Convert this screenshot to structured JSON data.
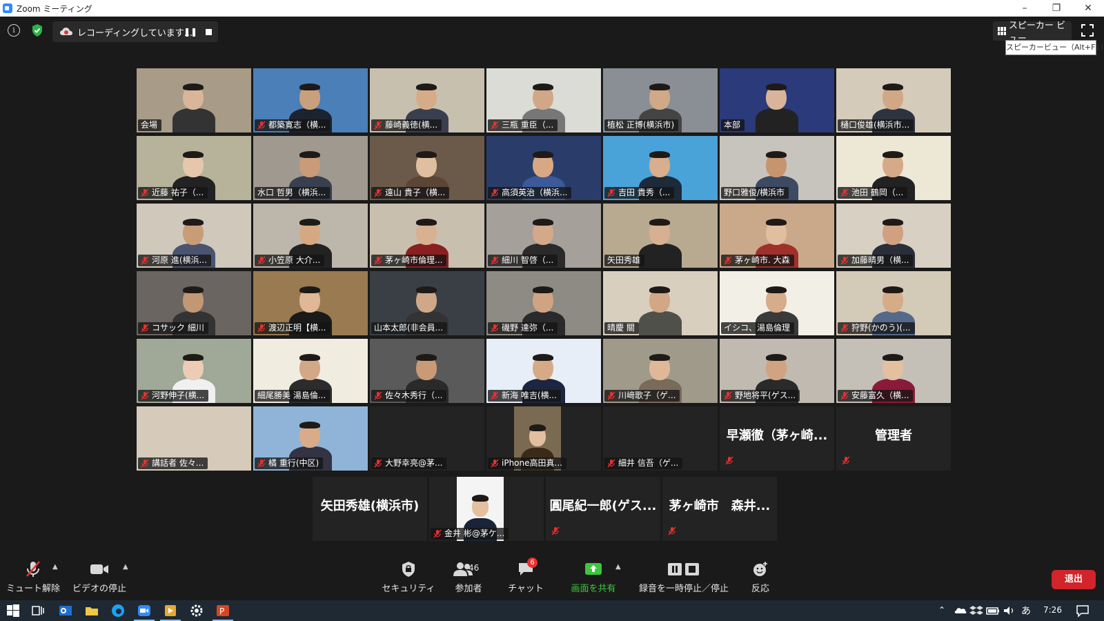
{
  "window": {
    "title": "Zoom ミーティング"
  },
  "topbar": {
    "recording_text": "レコーディングしています...",
    "speaker_view_label": "スピーカー ビュー",
    "tooltip": "スピーカービュー（Alt+F1）"
  },
  "participants": [
    {
      "name": "会場",
      "muted": false,
      "bg": "#a89c88",
      "skin": "#d9b59a",
      "shirt": "#333",
      "video": true
    },
    {
      "name": "都築寛志（横...",
      "muted": true,
      "bg": "#4a7fb8",
      "skin": "#c9a07c",
      "shirt": "#1c2330",
      "video": true
    },
    {
      "name": "藤崎義徳(横...",
      "muted": true,
      "bg": "#c8c0ae",
      "skin": "#d6ac88",
      "shirt": "#3a3f4f",
      "video": true
    },
    {
      "name": "三瓶 重臣（...",
      "muted": true,
      "bg": "#dcdcd6",
      "skin": "#d0a888",
      "shirt": "#777",
      "video": true
    },
    {
      "name": "植松 正博(横浜市)",
      "muted": false,
      "bg": "#8a8f96",
      "skin": "#cfa988",
      "shirt": "#444",
      "video": true
    },
    {
      "name": "本部",
      "muted": false,
      "bg": "#2a3a7a",
      "skin": "#d9b49a",
      "shirt": "#222",
      "video": true
    },
    {
      "name": "樋口俊雄(横浜市...",
      "muted": false,
      "bg": "#d5cbbb",
      "skin": "#d2a785",
      "shirt": "#2e3340",
      "video": true
    },
    {
      "name": "近藤 祐子（...",
      "muted": true,
      "bg": "#b7b29a",
      "skin": "#e6c6ac",
      "shirt": "#222",
      "video": true
    },
    {
      "name": "水口 哲男（横浜...",
      "muted": false,
      "bg": "#a09990",
      "skin": "#c99b78",
      "shirt": "#38404f",
      "video": true,
      "active": true
    },
    {
      "name": "遠山 貴子（横...",
      "muted": true,
      "bg": "#6b5a4a",
      "skin": "#e0bfa0",
      "shirt": "#5b4636",
      "video": true
    },
    {
      "name": "高須英治（横浜...",
      "muted": true,
      "bg": "#2a3d6a",
      "skin": "#d8a884",
      "shirt": "#3c5a9a",
      "video": true
    },
    {
      "name": "吉田 貴秀（...",
      "muted": true,
      "bg": "#4aa3d8",
      "skin": "#d8ae8c",
      "shirt": "#1d2a3a",
      "video": true
    },
    {
      "name": "野口雅俊/横浜市",
      "muted": false,
      "bg": "#c7c4bd",
      "skin": "#c79470",
      "shirt": "#3c4a62",
      "video": true
    },
    {
      "name": "池田 鶴岡（...",
      "muted": true,
      "bg": "#ede7d6",
      "skin": "#d6aa88",
      "shirt": "#222",
      "video": true
    },
    {
      "name": "河原 進(横浜...",
      "muted": true,
      "bg": "#cfc8bb",
      "skin": "#c99c78",
      "shirt": "#4a5470",
      "video": true
    },
    {
      "name": "小笠原 大介...",
      "muted": true,
      "bg": "#bdb6aa",
      "skin": "#d6a882",
      "shirt": "#222",
      "video": true
    },
    {
      "name": "茅ヶ崎市倫理...",
      "muted": true,
      "bg": "#c9bfae",
      "skin": "#d8b092",
      "shirt": "#8a1f1f",
      "video": true
    },
    {
      "name": "細川 智啓（...",
      "muted": true,
      "bg": "#a5a09a",
      "skin": "#d3a98a",
      "shirt": "#2a2a2a",
      "video": true
    },
    {
      "name": "矢田秀雄",
      "muted": false,
      "bg": "#b8aa90",
      "skin": "#d6b090",
      "shirt": "#222",
      "video": true
    },
    {
      "name": "茅ヶ崎市. 大森",
      "muted": true,
      "bg": "#caa98a",
      "skin": "#e2bea0",
      "shirt": "#a0302a",
      "video": true
    },
    {
      "name": "加藤晴男（横...",
      "muted": true,
      "bg": "#d8d0c2",
      "skin": "#cfa180",
      "shirt": "#2a2e3a",
      "video": true
    },
    {
      "name": "コサック 細川",
      "muted": true,
      "bg": "#6a6560",
      "skin": "#c29874",
      "shirt": "#333",
      "video": true
    },
    {
      "name": "渡辺正明【横...",
      "muted": true,
      "bg": "#9a7a50",
      "skin": "#e0b896",
      "shirt": "#1a1a1a",
      "video": true
    },
    {
      "name": "山本太郎(非会員...",
      "muted": false,
      "bg": "#3a3f46",
      "skin": "#d0a888",
      "shirt": "#333",
      "video": true
    },
    {
      "name": "磯野 達弥（...",
      "muted": true,
      "bg": "#8e8a84",
      "skin": "#d0a482",
      "shirt": "#2a2a2a",
      "video": true
    },
    {
      "name": "晴慶 關",
      "muted": false,
      "bg": "#d8cfbf",
      "skin": "#d1a786",
      "shirt": "#50504a",
      "video": true
    },
    {
      "name": "イシコ、湯島倫理",
      "muted": false,
      "bg": "#f2efe6",
      "skin": "#d6ac8a",
      "shirt": "#3a3a3a",
      "video": true
    },
    {
      "name": "狩野(かのう)(...",
      "muted": true,
      "bg": "#d4cab8",
      "skin": "#d6ac88",
      "shirt": "#556a8a",
      "video": true
    },
    {
      "name": "河野伸子(横...",
      "muted": true,
      "bg": "#a0a898",
      "skin": "#ecccb4",
      "shirt": "#f0f0f0",
      "video": true
    },
    {
      "name": "細尾勝美 湯島倫...",
      "muted": false,
      "bg": "#f1ece0",
      "skin": "#d3a886",
      "shirt": "#2c2c2c",
      "video": true
    },
    {
      "name": "佐々木秀行（...",
      "muted": true,
      "bg": "#5a5a5a",
      "skin": "#c89a76",
      "shirt": "#2a2a2a",
      "video": true
    },
    {
      "name": "新海 唯吉(横...",
      "muted": true,
      "bg": "#e8eef8",
      "skin": "#d6aa86",
      "shirt": "#1c2640",
      "video": true
    },
    {
      "name": "川﨑歌子（ゲ...",
      "muted": true,
      "bg": "#a09a8a",
      "skin": "#e0b898",
      "shirt": "#7a6a5a",
      "video": true
    },
    {
      "name": "野地将平(ゲス...",
      "muted": true,
      "bg": "#c0bab0",
      "skin": "#d0a482",
      "shirt": "#2a2a2a",
      "video": true
    },
    {
      "name": "安藤富久（横...",
      "muted": true,
      "bg": "#c4c0b8",
      "skin": "#e3c0a0",
      "shirt": "#8a1a3a",
      "video": true
    },
    {
      "name": "講話者 佐々...",
      "muted": true,
      "bg": "#d6cbbb",
      "skin": "#c9a080",
      "shirt": "#444",
      "video": true,
      "empty": true
    },
    {
      "name": "橘 重行(中区)",
      "muted": true,
      "bg": "#8fb4d8",
      "skin": "#d8ac8a",
      "shirt": "#334",
      "video": true
    },
    {
      "name": "大野幸亮@茅...",
      "muted": true,
      "video": false
    },
    {
      "name": "iPhone高田真...",
      "muted": true,
      "bg": "#7a6a52",
      "skin": "#e2bfa0",
      "shirt": "#3a2a1a",
      "video": true,
      "narrow": true
    },
    {
      "name": "細井 信吾（ゲ...",
      "muted": true,
      "video": false
    },
    {
      "name": "",
      "muted": true,
      "video": false,
      "bigname": "早瀬徹（茅ヶ崎..."
    },
    {
      "name": "",
      "muted": true,
      "video": false,
      "bigname": "管理者"
    }
  ],
  "bottom_row": [
    {
      "name": "",
      "muted": false,
      "bigname": "矢田秀雄(横浜市)",
      "video": false
    },
    {
      "name": "金井 彬@茅ケ...",
      "muted": true,
      "video": true,
      "bg": "#f4f4f4",
      "skin": "#e4c0a0",
      "shirt": "#1a2438",
      "narrow": true
    },
    {
      "name": "",
      "muted": true,
      "bigname": "圓尾紀一郎(ゲス...",
      "video": false
    },
    {
      "name": "",
      "muted": true,
      "bigname": "茅ヶ崎市　森井...",
      "video": false
    }
  ],
  "toolbar": {
    "unmute": "ミュート解除",
    "stop_video": "ビデオの停止",
    "security": "セキュリティ",
    "participants": "参加者",
    "participants_count": "46",
    "chat": "チャット",
    "chat_badge": "6",
    "share": "画面を共有",
    "pause_record": "録音を一時停止／停止",
    "reactions": "反応",
    "leave": "退出"
  },
  "taskbar": {
    "time": "7:26",
    "ime": "あ"
  },
  "colors": {
    "share_green": "#3ec63e",
    "leave_red": "#d1242b",
    "active_outline": "#e6e600"
  }
}
